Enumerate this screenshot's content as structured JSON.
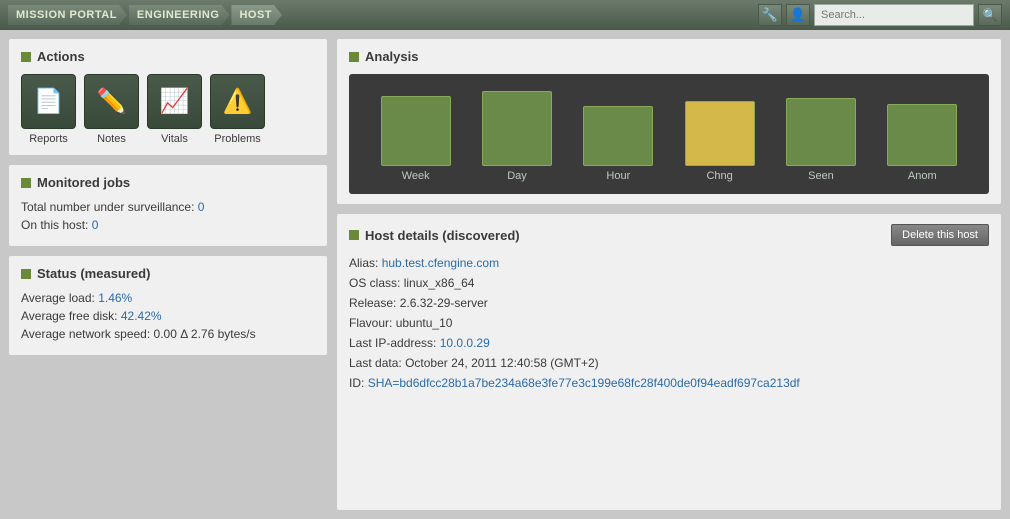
{
  "topbar": {
    "breadcrumbs": [
      {
        "label": "MISSION PORTAL"
      },
      {
        "label": "ENGINEERING"
      },
      {
        "label": "HOST"
      }
    ],
    "search_placeholder": "Search..."
  },
  "actions": {
    "title": "Actions",
    "items": [
      {
        "label": "Reports",
        "icon": "📄"
      },
      {
        "label": "Notes",
        "icon": "✏️"
      },
      {
        "label": "Vitals",
        "icon": "📈"
      },
      {
        "label": "Problems",
        "icon": "⚠️"
      }
    ]
  },
  "monitored_jobs": {
    "title": "Monitored jobs",
    "total_label": "Total number under surveillance:",
    "total_value": "0",
    "on_host_label": "On this host:",
    "on_host_value": "0"
  },
  "status": {
    "title": "Status (measured)",
    "avg_load_label": "Average load:",
    "avg_load_value": "1.46%",
    "avg_disk_label": "Average free disk:",
    "avg_disk_value": "42.42%",
    "avg_network_label": "Average network speed:",
    "avg_network_value": "0.00 Δ 2.76 bytes/s"
  },
  "analysis": {
    "title": "Analysis",
    "bars": [
      {
        "label": "Week",
        "height": 70,
        "color": "#6a8a4a"
      },
      {
        "label": "Day",
        "height": 75,
        "color": "#6a8a4a"
      },
      {
        "label": "Hour",
        "height": 60,
        "color": "#6a8a4a"
      },
      {
        "label": "Chng",
        "height": 65,
        "color": "#d4b84a"
      },
      {
        "label": "Seen",
        "height": 68,
        "color": "#6a8a4a"
      },
      {
        "label": "Anom",
        "height": 62,
        "color": "#6a8a4a"
      }
    ]
  },
  "host_details": {
    "title": "Host details (discovered)",
    "delete_label": "Delete this host",
    "alias_label": "Alias:",
    "alias_value": "hub.test.cfengine.com",
    "os_label": "OS class:",
    "os_value": "linux_x86_64",
    "release_label": "Release:",
    "release_value": "2.6.32-29-server",
    "flavour_label": "Flavour:",
    "flavour_value": "ubuntu_10",
    "ip_label": "Last IP-address:",
    "ip_value": "10.0.0.29",
    "last_data_label": "Last data:",
    "last_data_value": "October 24, 2011 12:40:58 (GMT+2)",
    "id_label": "ID:",
    "id_value": "SHA=bd6dfcc28b1a7be234a68e3fe77e3c199e68fc28f400de0f94eadf697ca213df"
  }
}
